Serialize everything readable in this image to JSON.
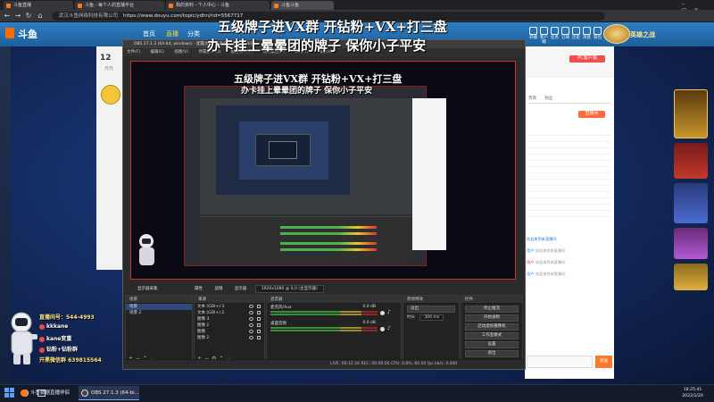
{
  "browser": {
    "tabs": [
      {
        "title": "斗鱼直播"
      },
      {
        "title": "斗鱼 - 每个人的直播平台"
      },
      {
        "title": "我的资料 - 个人中心 - 斗鱼"
      },
      {
        "title": "斗鱼斗鱼"
      }
    ],
    "address": {
      "site": "武汉斗鱼网络科技有限公司",
      "url": "https://www.douyu.com/topic/ydhn/rid=5567717"
    }
  },
  "site": {
    "logo": "斗鱼",
    "nav": [
      "首页",
      "直播",
      "分类"
    ],
    "header_icons": [
      "开播",
      "客户端",
      "任务",
      "订阅",
      "历史",
      "消息",
      "背包"
    ],
    "brand_right": "英雄之战"
  },
  "left_panel": {
    "number": "12",
    "unit": "元元"
  },
  "overlay": {
    "line1": "五级牌子进VX群  开钻粉+VX+打三盘",
    "line2": "办卡挂上晕晕团的牌子 保你小子平安",
    "nested_line1": "五级牌子进VX群  开钻粉+VX+打三盘",
    "nested_line2": "办卡挂上晕晕团的牌子 保你小子平安"
  },
  "chat_panel": {
    "buttons": [
      "PC客户端",
      "直播间",
      "贵宾",
      "粉丝",
      "发送"
    ],
    "lines": [
      {
        "user": "欢迎来到本直播间",
        "text": ""
      },
      {
        "user": "用户",
        "text": "欢迎来到本直播间"
      },
      {
        "user": "用户",
        "text": "欢迎来到本直播间"
      },
      {
        "user": "用户",
        "text": "欢迎来到本直播间"
      }
    ]
  },
  "obs": {
    "title": "OBS 27.1.3 (64-bit, windows) - 配置文件: 未命名 - 场景: 未命名",
    "menu": [
      "文件(F)",
      "编辑(E)",
      "视图(V)",
      "停靠部件(D)",
      "配置文件(P)",
      "场景集合(S)",
      "工具(T)",
      "帮助(H)"
    ],
    "source_bar": {
      "label": "显示器采集",
      "props": "属性",
      "filters": "滤镜",
      "display": "显示器",
      "resolution": "1920x1080 @ 0,0 (主显示器)"
    },
    "scenes": {
      "title": "场景",
      "items": [
        "场景",
        "场景 2"
      ]
    },
    "sources": {
      "title": "来源",
      "items": [
        "文本 (GDI+) 3",
        "文本 (GDI+) 2",
        "图像 3",
        "图像 2",
        "图像",
        "图像 2"
      ]
    },
    "mixer": {
      "title": "混音器",
      "channels": [
        {
          "name": "麦克风/Aux",
          "db": "0.0 dB"
        },
        {
          "name": "桌面音频",
          "db": "0.0 dB"
        }
      ]
    },
    "transitions": {
      "title": "转场特效",
      "type": "淡出",
      "duration_label": "时长",
      "duration": "300 ms"
    },
    "controls": {
      "title": "控件",
      "buttons": [
        "停止推流",
        "开始录制",
        "启动虚拟摄像机",
        "工作室模式",
        "设置",
        "退出"
      ]
    },
    "status": "LIVE: 00:12:34   REC: 00:00:00   CPU: 0.8%, 60.00 fps   kb/s: 4,400"
  },
  "streamer": {
    "lines": [
      "直播间号：544-4993",
      "kkkane",
      "kane变重",
      "钻粉+钻粉群",
      "开黑微信群 639815564"
    ]
  },
  "taskbar": {
    "items": [
      "斗鱼数据直播伴侣",
      "OBS 27.1.3 (64-bi..."
    ],
    "time": "18:25:41",
    "date": "2022/1/20"
  },
  "colors": {
    "accent": "#ff7a1a",
    "site_header": "#2f7fc4",
    "obs_bg": "#2b2b2b",
    "preview_border": "#c53030"
  }
}
